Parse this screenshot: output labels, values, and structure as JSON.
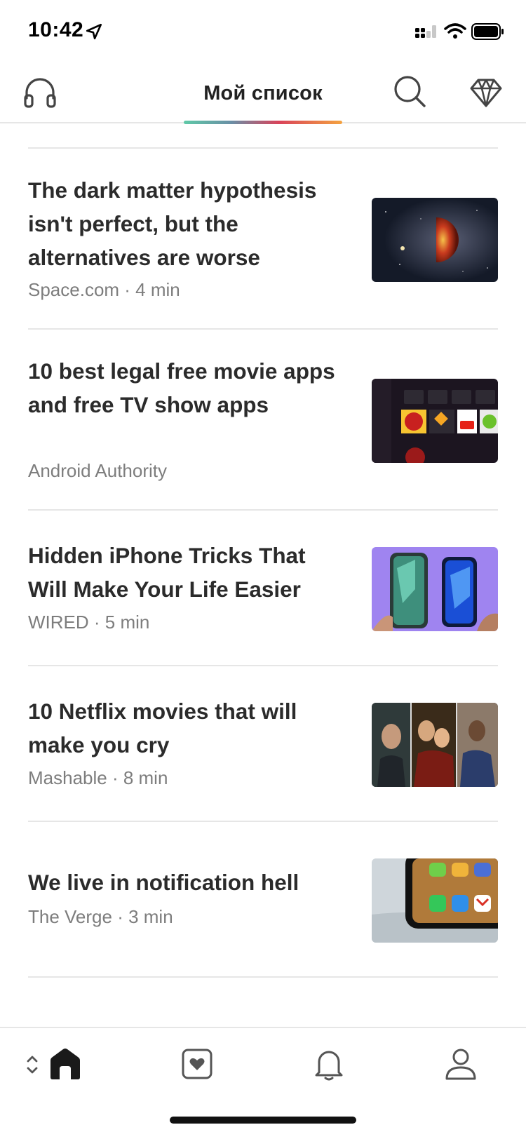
{
  "status_bar": {
    "time": "10:42"
  },
  "top_nav": {
    "active_tab": "Мой список",
    "icons": [
      "headphones-icon",
      "search-icon",
      "diamond-icon"
    ],
    "underline_colors": [
      "#5fc9a7",
      "#d9435a",
      "#f4a340"
    ]
  },
  "articles": [
    {
      "title": "The dark matter hypothesis isn't perfect, but the alternatives are worse",
      "meta": "Space.com · 4 min",
      "thumbnail": "galaxy-thumbnail"
    },
    {
      "title": "10 best legal free movie apps and free TV show apps",
      "meta": "Android Authority",
      "thumbnail": "tv-apps-thumbnail"
    },
    {
      "title": "Hidden iPhone Tricks That Will Make Your Life Easier",
      "meta": "WIRED · 5 min",
      "thumbnail": "iphones-thumbnail"
    },
    {
      "title": "10 Netflix movies that will make you cry",
      "meta": "Mashable · 8 min",
      "thumbnail": "movies-collage-thumbnail"
    },
    {
      "title": "We live in notification hell",
      "meta": "The Verge · 3 min",
      "thumbnail": "phone-apps-thumbnail"
    }
  ],
  "bottom_bar": {
    "tabs": [
      "home-icon",
      "saves-icon",
      "bell-icon",
      "profile-icon"
    ],
    "active": "home-icon"
  }
}
